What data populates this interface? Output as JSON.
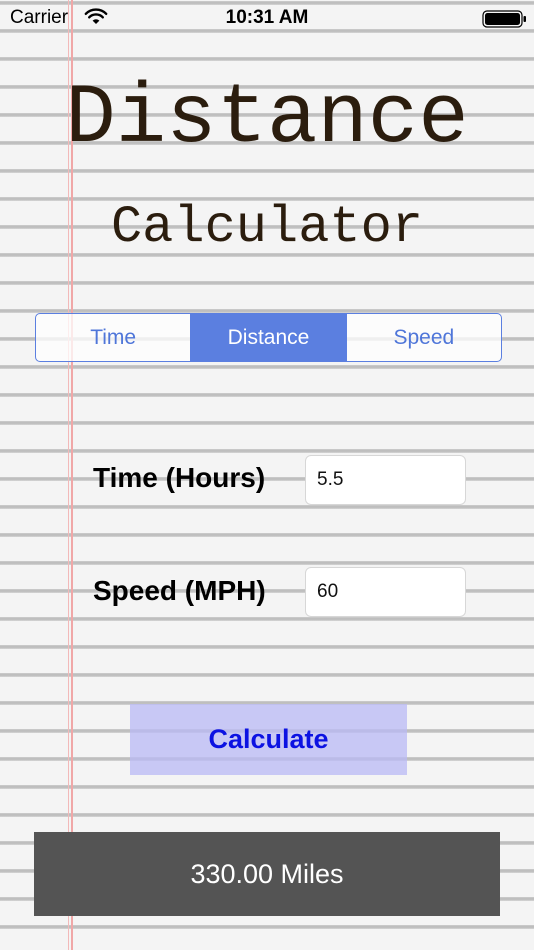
{
  "status_bar": {
    "carrier": "Carrier",
    "time": "10:31 AM",
    "icons": [
      "wifi-icon",
      "battery-icon"
    ]
  },
  "title": {
    "line1": "Distance",
    "line2": "Calculator"
  },
  "mode_selector": {
    "segments": [
      {
        "label": "Time",
        "active": false
      },
      {
        "label": "Distance",
        "active": true
      },
      {
        "label": "Speed",
        "active": false
      }
    ]
  },
  "form": {
    "time_label": "Time (Hours)",
    "time_value": "5.5",
    "speed_label": "Speed (MPH)",
    "speed_value": "60"
  },
  "calculate_label": "Calculate",
  "result": "330.00 Miles",
  "colors": {
    "accent": "#5b7fe0",
    "title_text": "#2b1d0e",
    "button_bg": "#b9b9f5",
    "button_text": "#0c12e2",
    "result_bg": "#545454",
    "margin_line": "#f0a7a7"
  }
}
